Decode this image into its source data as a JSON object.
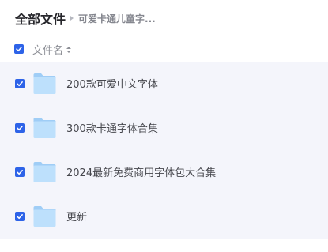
{
  "breadcrumb": {
    "root": "全部文件",
    "current": "可爱卡通儿童字..."
  },
  "table": {
    "header_label": "文件名",
    "header_checked": true
  },
  "files": [
    {
      "name": "200款可爱中文字体",
      "type": "folder",
      "checked": true
    },
    {
      "name": "300款卡通字体合集",
      "type": "folder",
      "checked": true
    },
    {
      "name": "2024最新免费商用字体包大合集",
      "type": "folder",
      "checked": true
    },
    {
      "name": "更新",
      "type": "folder",
      "checked": true
    }
  ],
  "icons": {
    "checkbox": "checkbox-checked-icon",
    "folder": "folder-icon",
    "sort": "sort-icon",
    "separator": "chevron-right-icon"
  },
  "colors": {
    "accent": "#2d63e8",
    "list_background": "#f4f5fb",
    "folder_light": "#b8dcfb",
    "folder_dark": "#8ec6f5"
  }
}
